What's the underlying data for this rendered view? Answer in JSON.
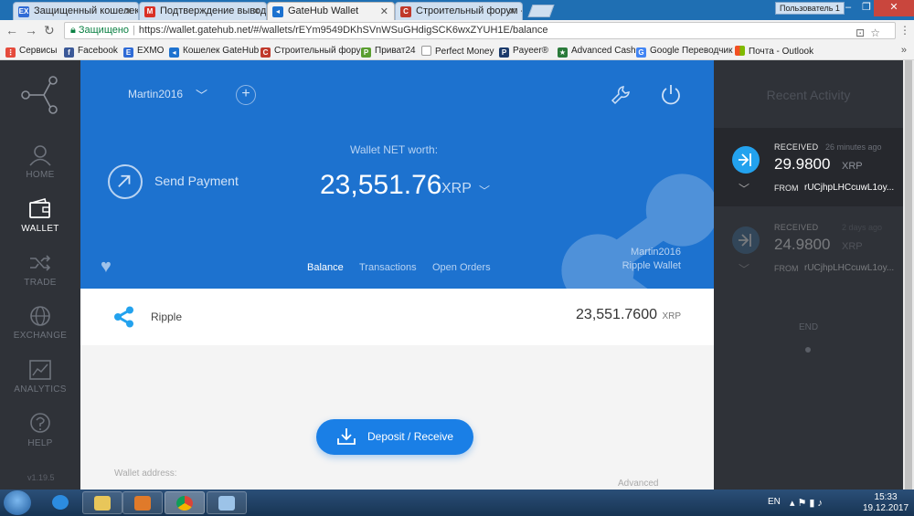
{
  "browser": {
    "tabs": [
      {
        "title": "Защищенный кошелек",
        "favicon": "EX",
        "favicon_color": "#2f6bd6",
        "active": false
      },
      {
        "title": "Подтверждение вывода",
        "favicon": "M",
        "favicon_color": "#d93025",
        "active": false
      },
      {
        "title": "GateHub Wallet",
        "favicon": "GH",
        "favicon_color": "#1d72cf",
        "active": true
      },
      {
        "title": "Строительный форум -",
        "favicon": "C",
        "favicon_color": "#c0392b",
        "active": false
      }
    ],
    "profile_label": "Пользователь 1",
    "address": {
      "secure_label": "Защищено",
      "url": "https://wallet.gatehub.net/#/wallets/rEYm9549DKhSVnWSuGHdigSCK6wxZYUH1E/balance"
    },
    "bookmarks": [
      {
        "label": "Сервисы",
        "icon": "apps-grid-icon",
        "color": "#e54b3c"
      },
      {
        "label": "Facebook",
        "icon": "facebook-icon",
        "color": "#3b5998"
      },
      {
        "label": "EXMO",
        "icon": "exmo-icon",
        "color": "#2f6bd6"
      },
      {
        "label": "Кошелек GateHub",
        "icon": "gatehub-icon",
        "color": "#1d72cf"
      },
      {
        "label": "Строительный фору",
        "icon": "forum-icon",
        "color": "#c0392b"
      },
      {
        "label": "Приват24",
        "icon": "privat24-icon",
        "color": "#5a9e2f"
      },
      {
        "label": "Perfect Money",
        "icon": "page-icon",
        "color": "#999999"
      },
      {
        "label": "Payeer®",
        "icon": "payeer-icon",
        "color": "#1b3a6b"
      },
      {
        "label": "Advanced Cash",
        "icon": "star-icon",
        "color": "#2a7a3a"
      },
      {
        "label": "Google Переводчик",
        "icon": "translate-icon",
        "color": "#4285f4"
      },
      {
        "label": "Почта - Outlook",
        "icon": "windows-icon",
        "color": "#f25022"
      }
    ]
  },
  "sidebar": {
    "items": [
      {
        "label": "HOME",
        "icon": "user-icon",
        "active": false
      },
      {
        "label": "WALLET",
        "icon": "wallet-icon",
        "active": true
      },
      {
        "label": "TRADE",
        "icon": "shuffle-icon",
        "active": false
      },
      {
        "label": "EXCHANGE",
        "icon": "globe-icon",
        "active": false
      },
      {
        "label": "ANALYTICS",
        "icon": "chart-icon",
        "active": false
      },
      {
        "label": "HELP",
        "icon": "help-icon",
        "active": false
      }
    ],
    "version": "v1.19.5"
  },
  "wallet": {
    "account_name": "Martin2016",
    "send_label": "Send Payment",
    "net_worth_label": "Wallet NET worth:",
    "net_worth_value": "23,551.76",
    "net_worth_unit": "XRP",
    "tabs": [
      "Balance",
      "Transactions",
      "Open Orders"
    ],
    "active_tab": "Balance",
    "wallet_name": "Martin2016",
    "wallet_type": "Ripple Wallet",
    "balances": [
      {
        "name": "Ripple",
        "amount": "23,551.7600",
        "unit": "XRP"
      }
    ],
    "deposit_label": "Deposit / Receive",
    "wallet_address_label": "Wallet address:",
    "advanced_label": "Advanced"
  },
  "activity": {
    "title": "Recent Activity",
    "items": [
      {
        "status": "RECEIVED",
        "time": "26 minutes ago",
        "amount": "29.9800",
        "unit": "XRP",
        "from_label": "FROM",
        "from": "rUCjhpLHCcuwL1oy..."
      },
      {
        "status": "RECEIVED",
        "time": "2 days ago",
        "amount": "24.9800",
        "unit": "XRP",
        "from_label": "FROM",
        "from": "rUCjhpLHCcuwL1oy..."
      }
    ],
    "end_label": "END"
  },
  "taskbar": {
    "lang": "EN",
    "time": "15:33",
    "date": "19.12.2017"
  },
  "colors": {
    "brand_blue": "#1d72cf",
    "button_blue": "#1a7fe6",
    "sidebar_dark": "#2f3238",
    "ripple_icon": "#23a2ee"
  }
}
